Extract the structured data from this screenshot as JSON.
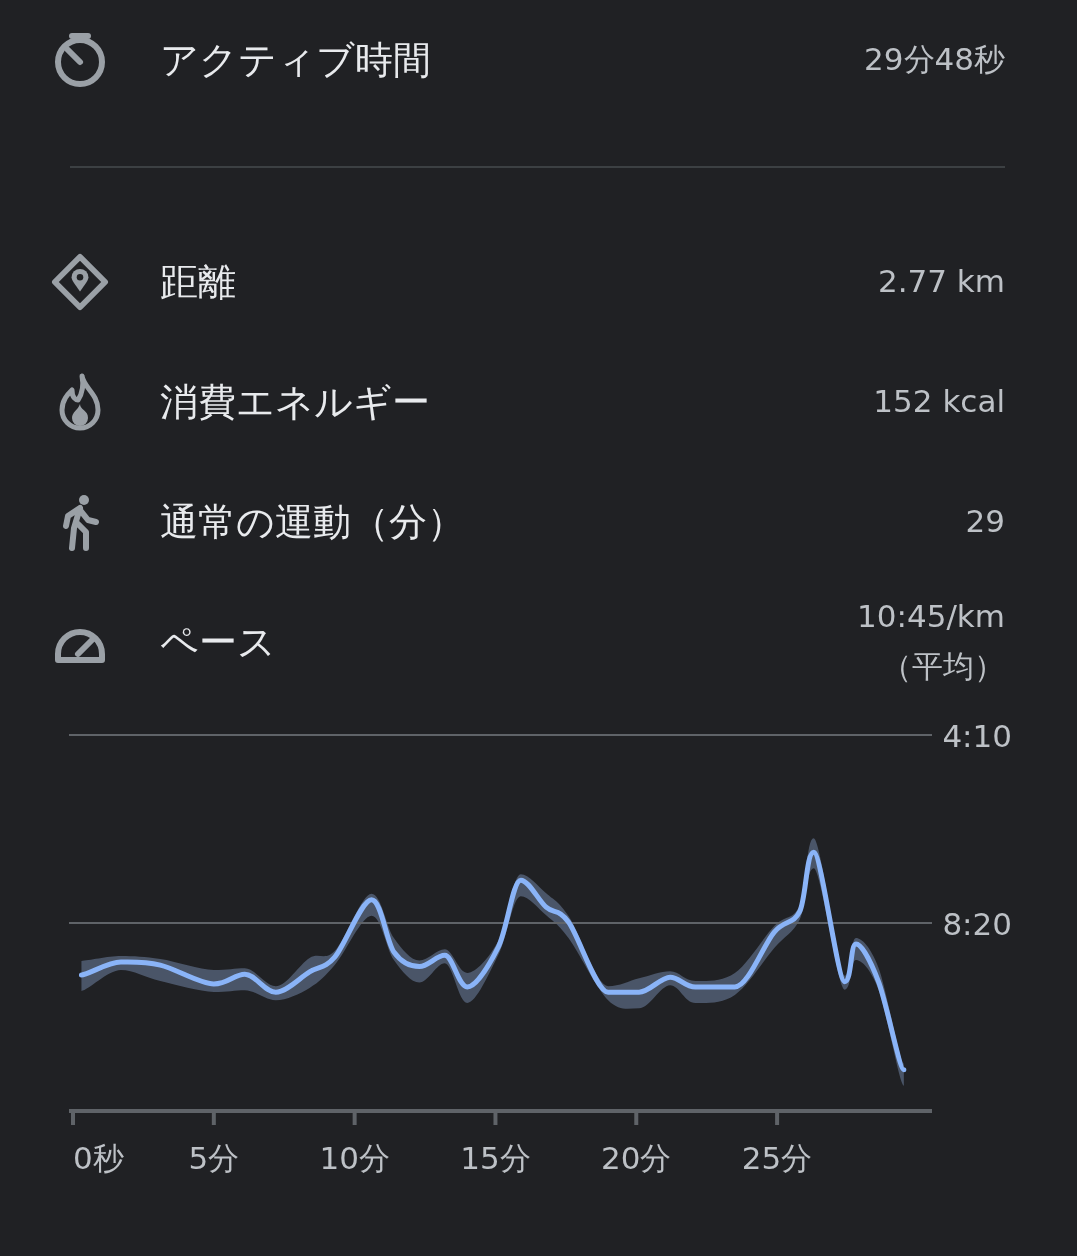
{
  "summary": {
    "label": "アクティブ時間",
    "value": "29分48秒"
  },
  "stats": [
    {
      "label": "距離",
      "value": "2.77 km"
    },
    {
      "label": "消費エネルギー",
      "value": "152 kcal"
    },
    {
      "label": "通常の運動（分）",
      "value": "29"
    },
    {
      "label": "ペース",
      "value": "10:45/km",
      "note": "（平均）"
    }
  ],
  "chart_data": {
    "type": "line",
    "xlim": [
      0,
      30.5
    ],
    "ylim": [
      750,
      250
    ],
    "xticks": [
      {
        "value": 0,
        "label": "0秒"
      },
      {
        "value": 5,
        "label": "5分"
      },
      {
        "value": 10,
        "label": "10分"
      },
      {
        "value": 15,
        "label": "15分"
      },
      {
        "value": 20,
        "label": "20分"
      },
      {
        "value": 25,
        "label": "25分"
      }
    ],
    "yticks": [
      {
        "value": 250,
        "label": "4:10"
      },
      {
        "value": 500,
        "label": "8:20"
      }
    ],
    "x": [
      0.3,
      1.7,
      3.1,
      5,
      6.1,
      7.2,
      8.4,
      9.3,
      10.6,
      11.4,
      12.3,
      13.2,
      14,
      15.1,
      15.9,
      16.8,
      17.6,
      19,
      20.1,
      21.2,
      22.1,
      23.5,
      24.9,
      25.8,
      26.3,
      27.4,
      27.8,
      28.6,
      29.5
    ],
    "series": [
      {
        "color": "#8ab4f8",
        "values": [
          569,
          552,
          556,
          581,
          568,
          592,
          565,
          545,
          469,
          539,
          558,
          543,
          585,
          532,
          443,
          479,
          499,
          592,
          592,
          572,
          585,
          585,
          512,
          485,
          406,
          578,
          528,
          578,
          695
        ]
      }
    ]
  }
}
